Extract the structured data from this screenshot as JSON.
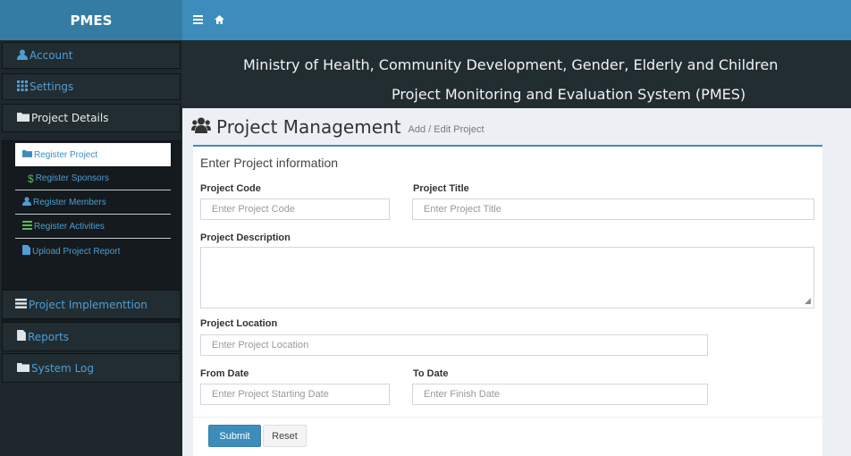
{
  "brand": "PMES",
  "sidebar": {
    "items": [
      {
        "label": "Account",
        "icon": "user-icon"
      },
      {
        "label": "Settings",
        "icon": "grid-icon"
      },
      {
        "label": "Project Details",
        "icon": "folder-icon"
      },
      {
        "label": "Project Implementtion",
        "icon": "list-icon"
      },
      {
        "label": "Reports",
        "icon": "file-icon"
      },
      {
        "label": "System Log",
        "icon": "folder-icon"
      }
    ],
    "sub_items": [
      {
        "label": "Register Project",
        "icon": "folder-icon"
      },
      {
        "label": "Register Sponsors",
        "icon": "dollar-icon"
      },
      {
        "label": "Register Members",
        "icon": "user-icon"
      },
      {
        "label": "Register Activities",
        "icon": "list-icon"
      },
      {
        "label": "Upload Project Report",
        "icon": "file-icon"
      }
    ]
  },
  "header": {
    "line1": "Ministry of Health, Community Development, Gender, Elderly and Children",
    "line2": "Project Monitoring and Evaluation System (PMES)"
  },
  "page": {
    "title": "Project Management",
    "subtitle": "Add / Edit Project"
  },
  "form": {
    "box_title": "Enter Project information",
    "project_code_label": "Project Code",
    "project_code_placeholder": "Enter Project Code",
    "project_title_label": "Project Title",
    "project_title_placeholder": "Enter Project Title",
    "description_label": "Project Description",
    "location_label": "Project Location",
    "location_placeholder": "Enter Project Location",
    "from_date_label": "From Date",
    "from_date_placeholder": "Enter Project Starting Date",
    "to_date_label": "To Date",
    "to_date_placeholder": "Enter Finish Date",
    "submit_label": "Submit",
    "reset_label": "Reset"
  },
  "colors": {
    "accent": "#3c8dbc",
    "sidebar_bg": "#222d32",
    "link_blue": "#4f9ed6",
    "dollar_green": "#5cb85c"
  }
}
